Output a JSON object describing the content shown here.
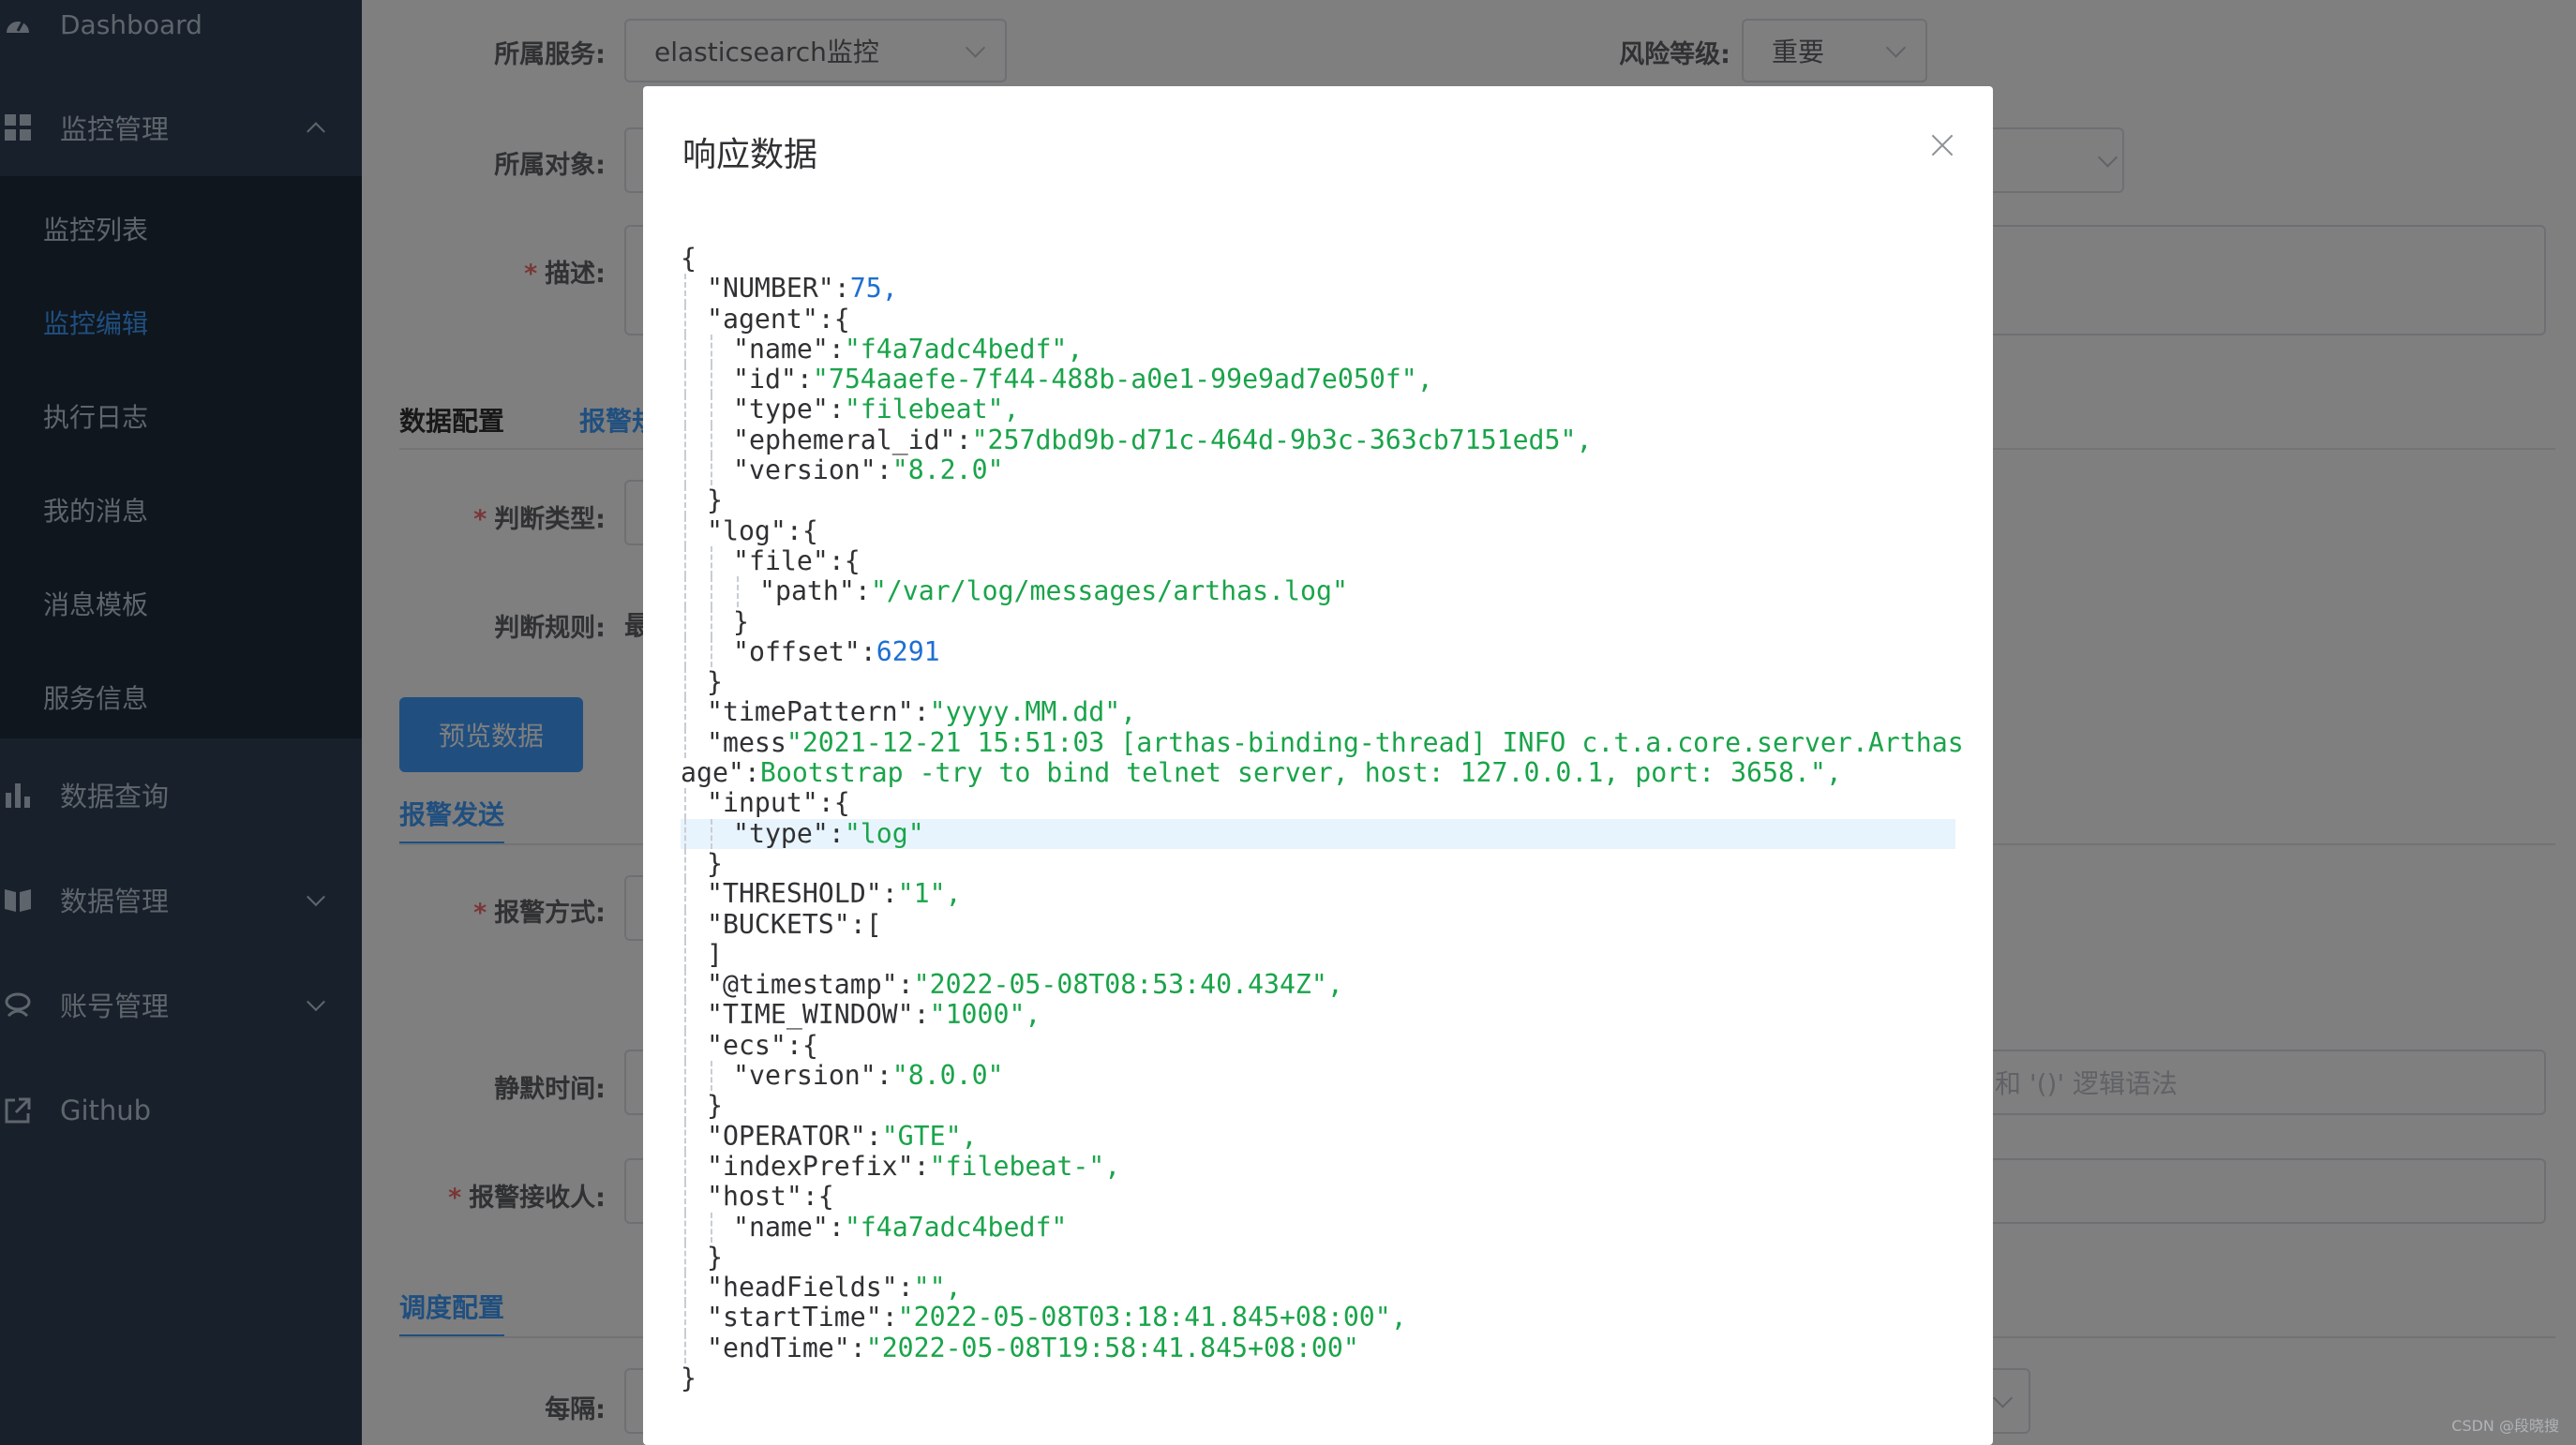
{
  "sidebar": {
    "dashboard": "Dashboard",
    "monitor_group": "监控管理",
    "monitor_items": [
      "监控列表",
      "监控编辑",
      "执行日志",
      "我的消息",
      "消息模板",
      "服务信息"
    ],
    "active_item": "监控编辑",
    "data_query": "数据查询",
    "data_manage": "数据管理",
    "account_manage": "账号管理",
    "github": "Github"
  },
  "form": {
    "service_label": "所属服务:",
    "service_value": "elasticsearch监控",
    "risk_label": "风险等级:",
    "risk_value": "重要",
    "object_label": "所属对象:",
    "desc_label": "描述:",
    "tab_data_config": "数据配置",
    "tab_alert": "报警规",
    "judge_type_label": "判断类型:",
    "judge_rule_label": "判断规则:",
    "judge_rule_value": "最",
    "preview_button": "预览数据",
    "alert_send_tab": "报警发送",
    "alert_method_label": "报警方式:",
    "silent_label": "静默时间:",
    "silent_hint": "和 '()' 逻辑语法",
    "receiver_label": "报警接收人:",
    "schedule_tab": "调度配置",
    "interval_label": "每隔:"
  },
  "dialog": {
    "title": "响应数据",
    "lines": [
      {
        "indent": 0,
        "tokens": [
          [
            "p",
            "{"
          ]
        ]
      },
      {
        "indent": 1,
        "tokens": [
          [
            "k",
            "\"NUMBER\""
          ],
          [
            "p",
            ":"
          ],
          [
            "n",
            "75"
          ],
          [
            "n",
            ","
          ]
        ]
      },
      {
        "indent": 1,
        "tokens": [
          [
            "k",
            "\"agent\""
          ],
          [
            "p",
            ":{"
          ]
        ]
      },
      {
        "indent": 2,
        "tokens": [
          [
            "k",
            "\"name\""
          ],
          [
            "p",
            ":"
          ],
          [
            "s",
            "\"f4a7adc4bedf\","
          ]
        ]
      },
      {
        "indent": 2,
        "tokens": [
          [
            "k",
            "\"id\""
          ],
          [
            "p",
            ":"
          ],
          [
            "s",
            "\"754aaefe-7f44-488b-a0e1-99e9ad7e050f\","
          ]
        ]
      },
      {
        "indent": 2,
        "tokens": [
          [
            "k",
            "\"type\""
          ],
          [
            "p",
            ":"
          ],
          [
            "s",
            "\"filebeat\","
          ]
        ]
      },
      {
        "indent": 2,
        "tokens": [
          [
            "k",
            "\"ephemeral_id\""
          ],
          [
            "p",
            ":"
          ],
          [
            "s",
            "\"257dbd9b-d71c-464d-9b3c-363cb7151ed5\","
          ]
        ]
      },
      {
        "indent": 2,
        "tokens": [
          [
            "k",
            "\"version\""
          ],
          [
            "p",
            ":"
          ],
          [
            "s",
            "\"8.2.0\""
          ]
        ]
      },
      {
        "indent": 1,
        "tokens": [
          [
            "p",
            "}"
          ]
        ]
      },
      {
        "indent": 1,
        "tokens": [
          [
            "k",
            "\"log\""
          ],
          [
            "p",
            ":{"
          ]
        ]
      },
      {
        "indent": 2,
        "tokens": [
          [
            "k",
            "\"file\""
          ],
          [
            "p",
            ":{"
          ]
        ]
      },
      {
        "indent": 3,
        "tokens": [
          [
            "k",
            "\"path\""
          ],
          [
            "p",
            ":"
          ],
          [
            "s",
            "\"/var/log/messages/arthas.log\""
          ]
        ]
      },
      {
        "indent": 2,
        "tokens": [
          [
            "p",
            "}"
          ]
        ]
      },
      {
        "indent": 2,
        "tokens": [
          [
            "k",
            "\"offset\""
          ],
          [
            "p",
            ":"
          ],
          [
            "n",
            "6291"
          ]
        ]
      },
      {
        "indent": 1,
        "tokens": [
          [
            "p",
            "}"
          ]
        ]
      },
      {
        "indent": 1,
        "tokens": [
          [
            "k",
            "\"timePattern\""
          ],
          [
            "p",
            ":"
          ],
          [
            "s",
            "\"yyyy.MM.dd\","
          ]
        ]
      },
      {
        "indent": 1,
        "tokens": [
          [
            "k",
            "\"mess"
          ],
          [
            "s",
            "\"2021-12-21 15:51:03 [arthas-binding-thread] INFO c.t.a.core.server.Arthas"
          ]
        ]
      },
      {
        "indent": 0,
        "tokens": [
          [
            "k",
            "age\""
          ],
          [
            "p",
            ":"
          ],
          [
            "s",
            "Bootstrap -try to bind telnet server, host: 127.0.0.1, port: 3658.\","
          ]
        ]
      },
      {
        "indent": 1,
        "tokens": [
          [
            "k",
            "\"input\""
          ],
          [
            "p",
            ":{"
          ]
        ]
      },
      {
        "indent": 2,
        "tokens": [
          [
            "k",
            "\"type\""
          ],
          [
            "p",
            ":"
          ],
          [
            "s",
            "\"log\""
          ]
        ],
        "highlight": true
      },
      {
        "indent": 1,
        "tokens": [
          [
            "p",
            "}"
          ]
        ]
      },
      {
        "indent": 1,
        "tokens": [
          [
            "k",
            "\"THRESHOLD\""
          ],
          [
            "p",
            ":"
          ],
          [
            "s",
            "\"1\","
          ]
        ]
      },
      {
        "indent": 1,
        "tokens": [
          [
            "k",
            "\"BUCKETS\""
          ],
          [
            "p",
            ":["
          ]
        ]
      },
      {
        "indent": 1,
        "tokens": [
          [
            "p",
            "]"
          ]
        ]
      },
      {
        "indent": 1,
        "tokens": [
          [
            "k",
            "\"@timestamp\""
          ],
          [
            "p",
            ":"
          ],
          [
            "s",
            "\"2022-05-08T08:53:40.434Z\","
          ]
        ]
      },
      {
        "indent": 1,
        "tokens": [
          [
            "k",
            "\"TIME_WINDOW\""
          ],
          [
            "p",
            ":"
          ],
          [
            "s",
            "\"1000\","
          ]
        ]
      },
      {
        "indent": 1,
        "tokens": [
          [
            "k",
            "\"ecs\""
          ],
          [
            "p",
            ":{"
          ]
        ]
      },
      {
        "indent": 2,
        "tokens": [
          [
            "k",
            "\"version\""
          ],
          [
            "p",
            ":"
          ],
          [
            "s",
            "\"8.0.0\""
          ]
        ]
      },
      {
        "indent": 1,
        "tokens": [
          [
            "p",
            "}"
          ]
        ]
      },
      {
        "indent": 1,
        "tokens": [
          [
            "k",
            "\"OPERATOR\""
          ],
          [
            "p",
            ":"
          ],
          [
            "s",
            "\"GTE\","
          ]
        ]
      },
      {
        "indent": 1,
        "tokens": [
          [
            "k",
            "\"indexPrefix\""
          ],
          [
            "p",
            ":"
          ],
          [
            "s",
            "\"filebeat-\","
          ]
        ]
      },
      {
        "indent": 1,
        "tokens": [
          [
            "k",
            "\"host\""
          ],
          [
            "p",
            ":{"
          ]
        ]
      },
      {
        "indent": 2,
        "tokens": [
          [
            "k",
            "\"name\""
          ],
          [
            "p",
            ":"
          ],
          [
            "s",
            "\"f4a7adc4bedf\""
          ]
        ]
      },
      {
        "indent": 1,
        "tokens": [
          [
            "p",
            "}"
          ]
        ]
      },
      {
        "indent": 1,
        "tokens": [
          [
            "k",
            "\"headFields\""
          ],
          [
            "p",
            ":"
          ],
          [
            "s",
            "\"\","
          ]
        ]
      },
      {
        "indent": 1,
        "tokens": [
          [
            "k",
            "\"startTime\""
          ],
          [
            "p",
            ":"
          ],
          [
            "s",
            "\"2022-05-08T03:18:41.845+08:00\","
          ]
        ]
      },
      {
        "indent": 1,
        "tokens": [
          [
            "k",
            "\"endTime\""
          ],
          [
            "p",
            ":"
          ],
          [
            "s",
            "\"2022-05-08T19:58:41.845+08:00\""
          ]
        ]
      },
      {
        "indent": 0,
        "tokens": [
          [
            "p",
            "}"
          ]
        ]
      }
    ]
  },
  "watermark": "CSDN @段晓搜",
  "colors": {
    "sidebar_bg": "#304156",
    "submenu_bg": "#1f2d3d",
    "accent": "#409eff",
    "json_string": "#1aa44a",
    "json_number": "#1d6fd2"
  }
}
